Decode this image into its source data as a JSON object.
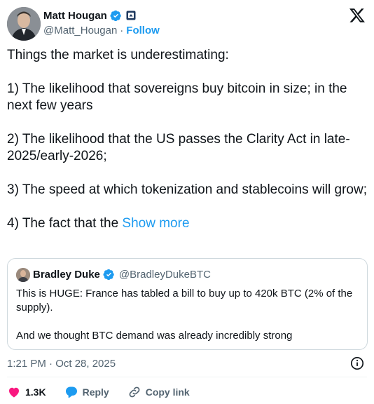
{
  "author": {
    "name": "Matt Hougan",
    "handle": "@Matt_Hougan",
    "separator": "·",
    "follow_label": "Follow"
  },
  "tweet": {
    "paragraphs": [
      "Things the market is underestimating:",
      "1) The likelihood that sovereigns buy bitcoin in size; in the next few years",
      "2) The likelihood that the US passes the Clarity Act in late-2025/early-2026;",
      "3) The speed at which tokenization and stablecoins will grow;"
    ],
    "truncated_start": "4) The fact that the ",
    "show_more_label": "Show more"
  },
  "quote": {
    "name": "Bradley Duke",
    "handle": "@BradleyDukeBTC",
    "paragraphs": [
      "This is HUGE: France has tabled a bill to buy up to 420k BTC (2% of the supply).",
      "And we thought BTC demand was already incredibly strong"
    ]
  },
  "meta": {
    "timestamp": "1:21 PM · Oct 28, 2025"
  },
  "actions": {
    "like_count": "1.3K",
    "reply_label": "Reply",
    "copy_link_label": "Copy link"
  },
  "colors": {
    "accent": "#1d9bf0",
    "like": "#f91880",
    "secondary_text": "#536471",
    "border": "#cfd9de"
  },
  "icons": [
    "verified-badge-icon",
    "affiliate-badge-icon",
    "x-logo-icon",
    "info-icon",
    "heart-icon",
    "reply-bubble-icon",
    "link-icon"
  ]
}
